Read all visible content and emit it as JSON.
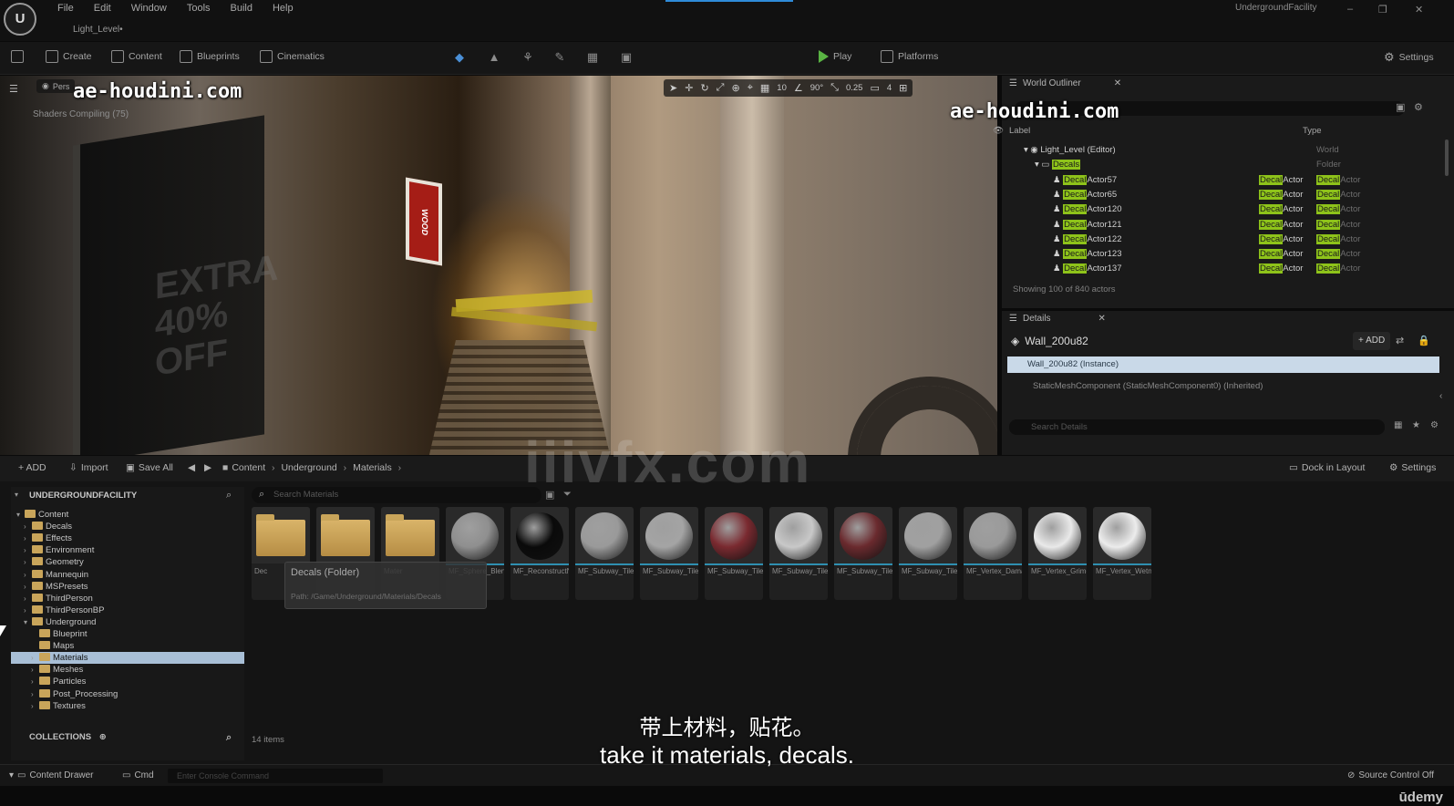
{
  "app": {
    "logo": "U",
    "menu": [
      "File",
      "Edit",
      "Window",
      "Tools",
      "Build",
      "Help"
    ],
    "level_tab": "Light_Level•",
    "project_name": "UndergroundFacility",
    "window_controls": [
      "–",
      "❐",
      "✕"
    ]
  },
  "toolbar": {
    "create": "Create",
    "content": "Content",
    "blueprints": "Blueprints",
    "cinematics": "Cinematics",
    "play": "Play",
    "platforms": "Platforms",
    "settings": "Settings"
  },
  "viewport": {
    "perspective": "Pers",
    "shaders": "Shaders Compiling (75)",
    "grid": "10",
    "angle": "90°",
    "scale": "0.25",
    "camera_speed": "4",
    "sign_text": "WOOD"
  },
  "outliner": {
    "title": "World Outliner",
    "col_label": "Label",
    "col_type": "Type",
    "rows": [
      {
        "indent": 24,
        "label": "Light_Level (Editor)",
        "hl": "",
        "type": "World",
        "type_hl": "",
        "type2": ""
      },
      {
        "indent": 36,
        "label": "",
        "hl": "Decals",
        "type": "Folder",
        "type_hl": "",
        "type2": ""
      },
      {
        "indent": 56,
        "label": "Actor57",
        "hl": "Decal",
        "type": "Actor",
        "type_hl": "Decal",
        "type2": "Actor"
      },
      {
        "indent": 56,
        "label": "Actor65",
        "hl": "Decal",
        "type": "Actor",
        "type_hl": "Decal",
        "type2": "Actor"
      },
      {
        "indent": 56,
        "label": "Actor120",
        "hl": "Decal",
        "type": "Actor",
        "type_hl": "Decal",
        "type2": "Actor"
      },
      {
        "indent": 56,
        "label": "Actor121",
        "hl": "Decal",
        "type": "Actor",
        "type_hl": "Decal",
        "type2": "Actor"
      },
      {
        "indent": 56,
        "label": "Actor122",
        "hl": "Decal",
        "type": "Actor",
        "type_hl": "Decal",
        "type2": "Actor"
      },
      {
        "indent": 56,
        "label": "Actor123",
        "hl": "Decal",
        "type": "Actor",
        "type_hl": "Decal",
        "type2": "Actor"
      },
      {
        "indent": 56,
        "label": "Actor137",
        "hl": "Decal",
        "type": "Actor",
        "type_hl": "Decal",
        "type2": "Actor"
      }
    ],
    "count": "Showing 100 of 840 actors"
  },
  "details": {
    "title": "Details",
    "selected": "Wall_200u82",
    "add": "+ ADD",
    "instance": "Wall_200u82 (Instance)",
    "component": "StaticMeshComponent (StaticMeshComponent0) (Inherited)",
    "search_placeholder": "Search Details"
  },
  "content_browser": {
    "add": "+ ADD",
    "import": "Import",
    "save_all": "Save All",
    "breadcrumbs": [
      "Content",
      "Underground",
      "Materials"
    ],
    "dock": "Dock in Layout",
    "settings": "Settings",
    "tree_header": "UNDERGROUNDFACILITY",
    "tree": [
      {
        "indent": 6,
        "arrow": "▾",
        "label": "Content",
        "selected": false
      },
      {
        "indent": 14,
        "arrow": "›",
        "label": "Decals",
        "selected": false
      },
      {
        "indent": 14,
        "arrow": "›",
        "label": "Effects",
        "selected": false
      },
      {
        "indent": 14,
        "arrow": "›",
        "label": "Environment",
        "selected": false
      },
      {
        "indent": 14,
        "arrow": "›",
        "label": "Geometry",
        "selected": false
      },
      {
        "indent": 14,
        "arrow": "›",
        "label": "Mannequin",
        "selected": false
      },
      {
        "indent": 14,
        "arrow": "›",
        "label": "MSPresets",
        "selected": false
      },
      {
        "indent": 14,
        "arrow": "›",
        "label": "ThirdPerson",
        "selected": false
      },
      {
        "indent": 14,
        "arrow": "›",
        "label": "ThirdPersonBP",
        "selected": false
      },
      {
        "indent": 14,
        "arrow": "▾",
        "label": "Underground",
        "selected": false
      },
      {
        "indent": 22,
        "arrow": "",
        "label": "Blueprint",
        "selected": false
      },
      {
        "indent": 22,
        "arrow": "",
        "label": "Maps",
        "selected": false
      },
      {
        "indent": 22,
        "arrow": "›",
        "label": "Materials",
        "selected": true
      },
      {
        "indent": 22,
        "arrow": "›",
        "label": "Meshes",
        "selected": false
      },
      {
        "indent": 22,
        "arrow": "›",
        "label": "Particles",
        "selected": false
      },
      {
        "indent": 22,
        "arrow": "›",
        "label": "Post_Processing",
        "selected": false
      },
      {
        "indent": 22,
        "arrow": "›",
        "label": "Textures",
        "selected": false
      }
    ],
    "collections": "COLLECTIONS",
    "search_placeholder": "Search Materials",
    "assets": [
      {
        "kind": "folder",
        "name": "Dec"
      },
      {
        "kind": "folder",
        "name": ""
      },
      {
        "kind": "folder",
        "name": "Mater"
      },
      {
        "kind": "sphere",
        "name": "MF_Sphere_Blend",
        "color": "#8f8f8f"
      },
      {
        "kind": "sphere",
        "name": "MF_ReconstructNormal",
        "color": "#0a0a0a"
      },
      {
        "kind": "sphere",
        "name": "MF_Subway_Tiles_Clean_RSB",
        "color": "#9a9a9a"
      },
      {
        "kind": "sphere",
        "name": "MF_Subway_Tiles_Clean_White",
        "color": "#a4a4a4"
      },
      {
        "kind": "sphere",
        "name": "MF_Subway_Tiles_Damaged",
        "color": "#7a2a30"
      },
      {
        "kind": "sphere",
        "name": "MF_Subway_Tiles_Damaged",
        "color": "#c8c8c8"
      },
      {
        "kind": "sphere",
        "name": "MF_Subway_Tiles_Grime_Edit",
        "color": "#6a2a2e"
      },
      {
        "kind": "sphere",
        "name": "MF_Subway_Tiles_Grime_White",
        "color": "#a0a0a0"
      },
      {
        "kind": "sphere",
        "name": "MF_Vertex_Damage",
        "color": "#9a9a9a"
      },
      {
        "kind": "sphere",
        "name": "MF_Vertex_Grime",
        "color": "#e9e9e9"
      },
      {
        "kind": "sphere",
        "name": "MF_Vertex_Wetness",
        "color": "#ececec"
      }
    ],
    "tooltip_title": "Decals (Folder)",
    "tooltip_path": "Path: /Game/Underground/Materials/Decals",
    "item_count": "14 items"
  },
  "statusbar": {
    "content_drawer": "Content Drawer",
    "cmd": "Cmd",
    "cmd_placeholder": "Enter Console Command",
    "source_control": "Source Control Off"
  },
  "overlay": {
    "watermark_left": "ae-houdini.com",
    "watermark_right": "ae-houdini.com",
    "big_watermark": "iiivfx.com",
    "subtitle_zh": "带上材料，贴花。",
    "subtitle_en": "take it materials, decals.",
    "brand": "ūdemy"
  }
}
